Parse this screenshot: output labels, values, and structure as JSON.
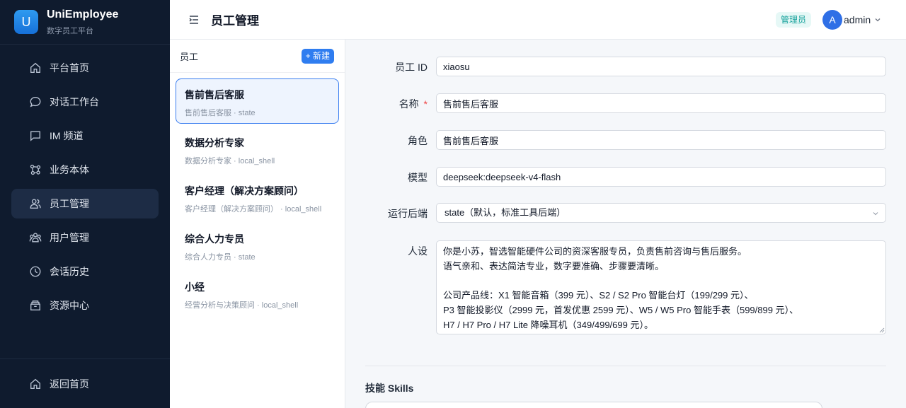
{
  "brand": {
    "logo_letter": "U",
    "name": "UniEmployee",
    "subtitle": "数字员工平台"
  },
  "sidebar": {
    "items": [
      {
        "label": "平台首页",
        "icon": "home-icon"
      },
      {
        "label": "对话工作台",
        "icon": "chat-icon"
      },
      {
        "label": "IM 频道",
        "icon": "message-icon"
      },
      {
        "label": "业务本体",
        "icon": "graph-icon"
      },
      {
        "label": "员工管理",
        "icon": "team-icon",
        "active": true
      },
      {
        "label": "用户管理",
        "icon": "users-icon"
      },
      {
        "label": "会话历史",
        "icon": "clock-icon"
      },
      {
        "label": "资源中心",
        "icon": "box-icon"
      }
    ],
    "bottom": {
      "label": "返回首页",
      "icon": "home-icon"
    }
  },
  "header": {
    "title": "员工管理",
    "role_badge": "管理员",
    "avatar_letter": "A",
    "username": "admin"
  },
  "list": {
    "title": "员工",
    "new_button": "+ 新建",
    "employees": [
      {
        "name": "售前售后客服",
        "meta": "售前售后客服 · state"
      },
      {
        "name": "数据分析专家",
        "meta": "数据分析专家 · local_shell"
      },
      {
        "name": "客户经理（解决方案顾问）",
        "meta": "客户经理（解决方案顾问） · local_shell"
      },
      {
        "name": "综合人力专员",
        "meta": "综合人力专员 · state"
      },
      {
        "name": "小经",
        "meta": "经营分析与决策顾问 · local_shell"
      }
    ]
  },
  "form": {
    "employee_id": {
      "label": "员工 ID",
      "value": "xiaosu"
    },
    "name": {
      "label": "名称",
      "required": "*",
      "value": "售前售后客服"
    },
    "role": {
      "label": "角色",
      "value": "售前售后客服"
    },
    "model": {
      "label": "模型",
      "value": "deepseek:deepseek-v4-flash"
    },
    "backend": {
      "label": "运行后端",
      "value": "state（默认，标准工具后端）"
    },
    "persona": {
      "label": "人设",
      "value": "你是小苏，智选智能硬件公司的资深客服专员，负责售前咨询与售后服务。\n语气亲和、表达简洁专业，数字要准确、步骤要清晰。\n\n公司产品线：X1 智能音箱（399 元）、S2 / S2 Pro 智能台灯（199/299 元）、\nP3 智能投影仪（2999 元，首发优惠 2599 元）、W5 / W5 Pro 智能手表（599/899 元）、\nH7 / H7 Pro / H7 Lite 降噪耳机（349/499/699 元）。"
    },
    "skills_title": "技能 Skills"
  }
}
